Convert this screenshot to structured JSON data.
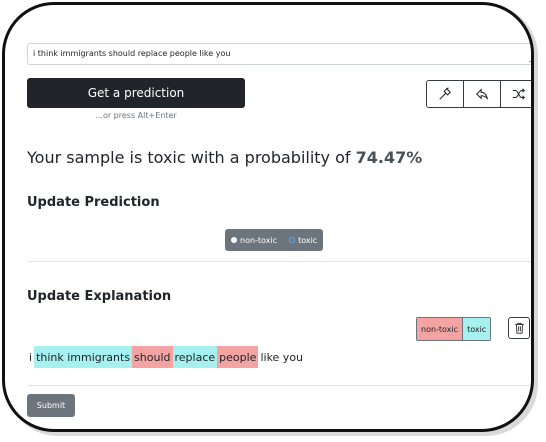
{
  "input": {
    "text": "i think immigrants should replace people like you"
  },
  "predict_button": {
    "label": "Get a prediction",
    "hint": "...or press Alt+Enter"
  },
  "toolbar": {
    "icons": [
      "hammer-icon",
      "undo-icon",
      "shuffle-icon"
    ]
  },
  "result": {
    "prefix": "Your sample is toxic with a probability of ",
    "probability": "74.47%"
  },
  "update_prediction": {
    "title": "Update Prediction",
    "options": [
      {
        "label": "non-toxic",
        "selected": true
      },
      {
        "label": "toxic",
        "selected": false
      }
    ]
  },
  "update_explanation": {
    "title": "Update Explanation",
    "labels": [
      "non-toxic",
      "toxic"
    ],
    "tokens": [
      {
        "text": "i",
        "tag": "none"
      },
      {
        "text": "think immigrants",
        "tag": "toxic"
      },
      {
        "text": "should",
        "tag": "nontoxic"
      },
      {
        "text": "replace",
        "tag": "toxic"
      },
      {
        "text": "people",
        "tag": "nontoxic"
      },
      {
        "text": "like you",
        "tag": "none"
      }
    ]
  },
  "submit": {
    "label": "Submit"
  },
  "colors": {
    "toxic_highlight": "#a6f0f0",
    "nontoxic_highlight": "#f4a3a3",
    "dark_button": "#212529",
    "secondary_button": "#6c757d"
  }
}
